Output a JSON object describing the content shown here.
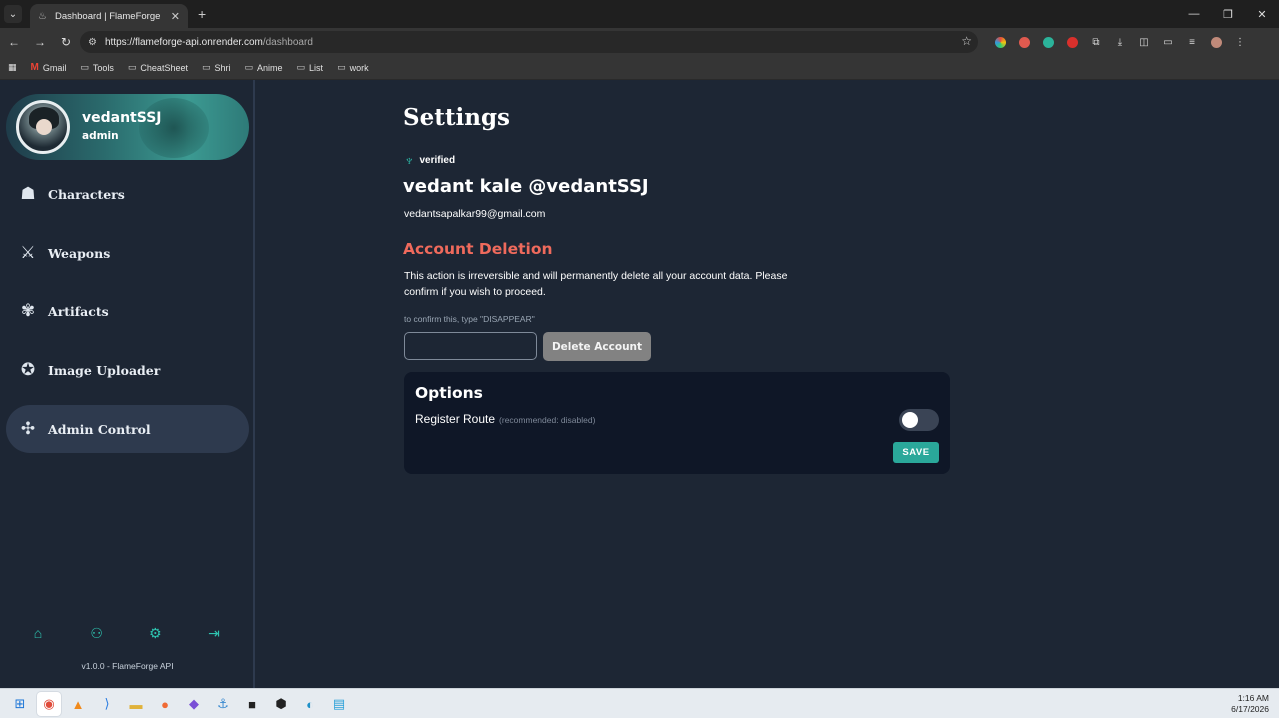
{
  "browser": {
    "tab_title": "Dashboard | FlameForge",
    "tab_close": "✕",
    "new_tab": "+",
    "url_host": "https://flameforge-api.onrender.com",
    "url_path": "/dashboard",
    "bookmarks": [
      "Gmail",
      "Tools",
      "CheatSheet",
      "Shri",
      "Anime",
      "List",
      "work"
    ]
  },
  "sidebar": {
    "username": "vedantSSJ",
    "role": "admin",
    "items": [
      {
        "label": "Characters",
        "icon": "character-icon",
        "glyph": "☗"
      },
      {
        "label": "Weapons",
        "icon": "sword-icon",
        "glyph": "⚔"
      },
      {
        "label": "Artifacts",
        "icon": "artifact-icon",
        "glyph": "✾"
      },
      {
        "label": "Image Uploader",
        "icon": "uploader-icon",
        "glyph": "✪"
      },
      {
        "label": "Admin Control",
        "icon": "admin-icon",
        "glyph": "✣",
        "active": true
      }
    ],
    "version": "v1.0.0 - FlameForge API"
  },
  "settings": {
    "title": "Settings",
    "verified": "verified",
    "full_name": "vedant kale @vedantSSJ",
    "email": "vedantsapalkar99@gmail.com",
    "deletion": {
      "title": "Account Deletion",
      "description": "This action is irreversible and will permanently delete all your account data. Please confirm if you wish to proceed.",
      "hint": "to confirm this, type \"DISAPPEAR\"",
      "input_value": "",
      "button": "Delete Account"
    },
    "options": {
      "title": "Options",
      "register_label": "Register Route",
      "register_note": "(recommended: disabled)",
      "register_enabled": false,
      "save": "SAVE"
    }
  },
  "taskbar": {
    "time": "1:16 AM",
    "date": "6/17/2026"
  },
  "colors": {
    "accent": "#2ec4b0",
    "danger": "#ef6a5c",
    "background": "#1d2634",
    "panel": "#0f1727"
  }
}
